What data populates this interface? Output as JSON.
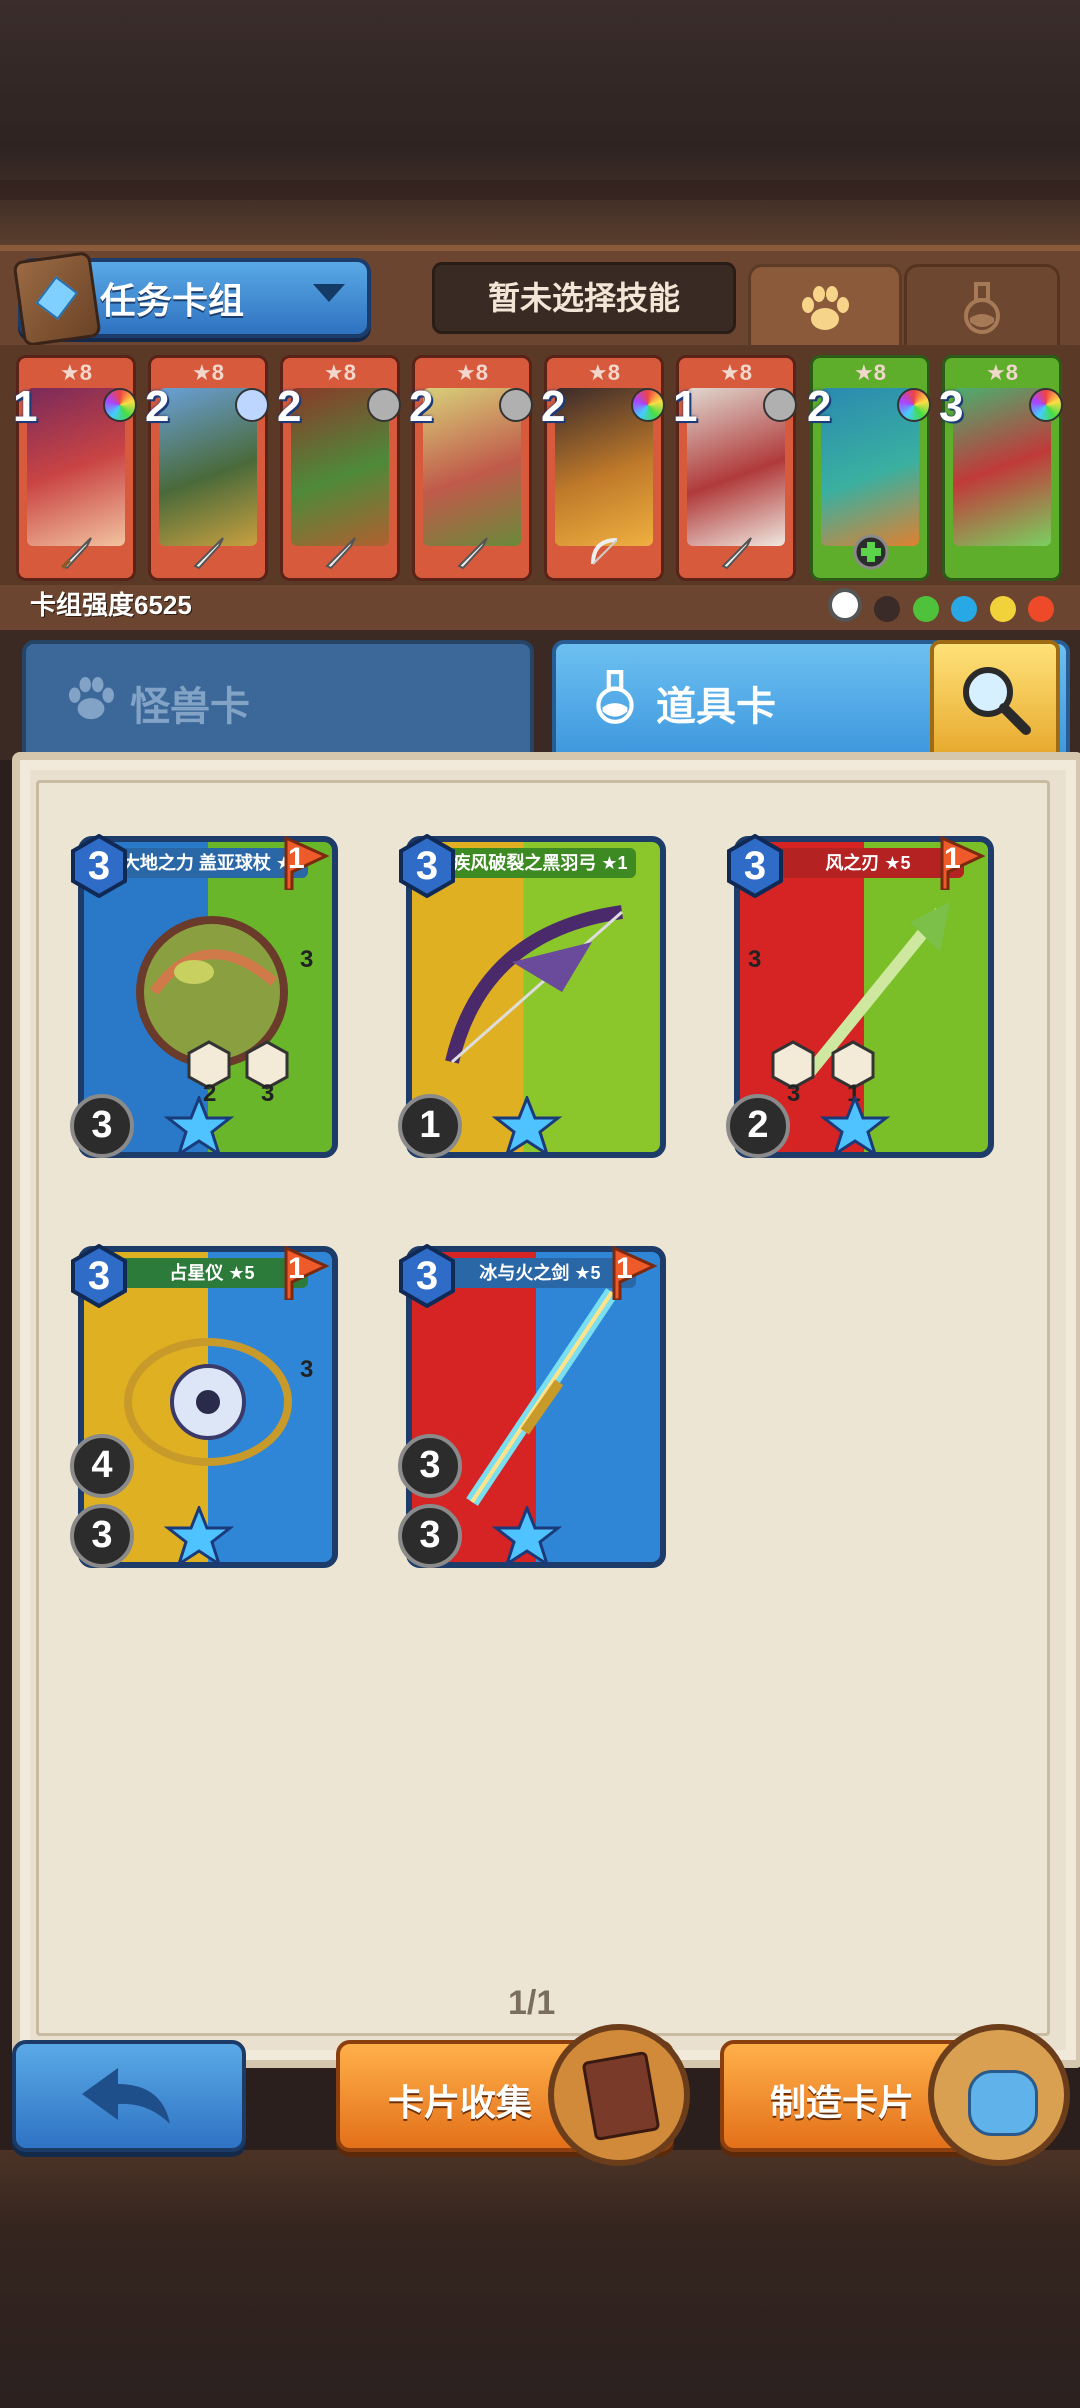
{
  "header": {
    "deck_label": "任务卡组",
    "skill_label": "暂未选择技能"
  },
  "deck": {
    "cards": [
      {
        "stars": "★8",
        "cost": "1",
        "frame": "red",
        "gem": "rainbow"
      },
      {
        "stars": "★8",
        "cost": "2",
        "frame": "red",
        "gem": "blue"
      },
      {
        "stars": "★8",
        "cost": "2",
        "frame": "red",
        "gem": "gray"
      },
      {
        "stars": "★8",
        "cost": "2",
        "frame": "red",
        "gem": "gray"
      },
      {
        "stars": "★8",
        "cost": "2",
        "frame": "red",
        "gem": "rainbow"
      },
      {
        "stars": "★8",
        "cost": "1",
        "frame": "red",
        "gem": "gray"
      },
      {
        "stars": "★8",
        "cost": "2",
        "frame": "green",
        "gem": "rainbow"
      },
      {
        "stars": "★8",
        "cost": "3",
        "frame": "green",
        "gem": "rainbow"
      }
    ],
    "power_label": "卡组强度6525"
  },
  "tabs": {
    "monster_label": "怪兽卡",
    "item_label": "道具卡"
  },
  "cards": [
    {
      "title": "大地之力 盖亚球杖 ★5",
      "cost": "3",
      "flag": "1",
      "stat1": "3",
      "hex1": "2",
      "hex2": "3",
      "side": "3"
    },
    {
      "title": "疾风破裂之黑羽弓 ★1",
      "cost": "3",
      "flag": "",
      "stat1": "1"
    },
    {
      "title": "风之刃 ★5",
      "cost": "3",
      "flag": "1",
      "stat1": "2",
      "hex1": "3",
      "hex2": "1",
      "side": "3"
    },
    {
      "title": "占星仪 ★5",
      "cost": "3",
      "flag": "1",
      "stat1": "4",
      "stat2": "3",
      "side": "3"
    },
    {
      "title": "冰与火之剑 ★5",
      "cost": "3",
      "flag": "1",
      "stat1": "3",
      "stat2": "3"
    }
  ],
  "page": "1/1",
  "buttons": {
    "collect_label": "卡片收集",
    "craft_label": "制造卡片"
  }
}
